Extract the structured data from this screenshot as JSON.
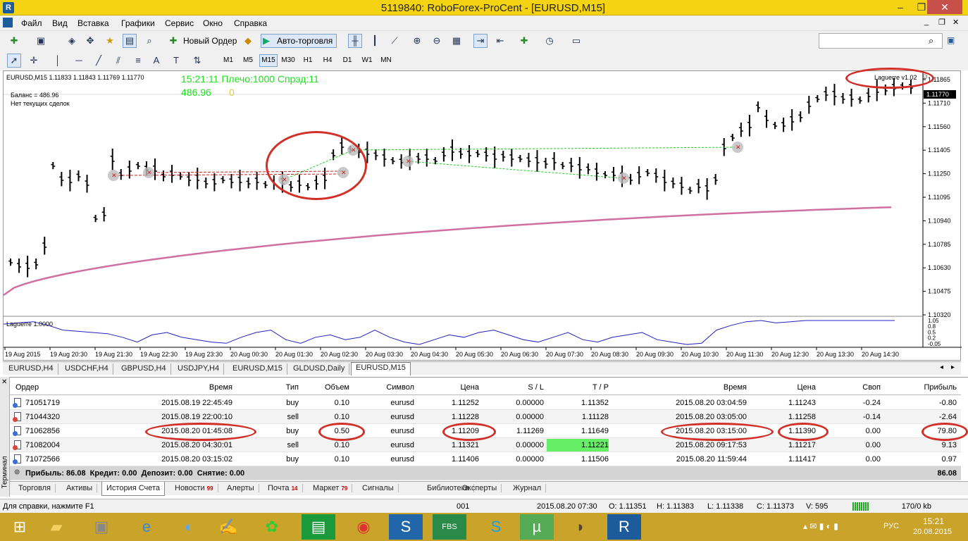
{
  "window": {
    "title": "5119840: RoboForex-ProCent - [EURUSD,M15]"
  },
  "menu": [
    "Файл",
    "Вид",
    "Вставка",
    "Графики",
    "Сервис",
    "Окно",
    "Справка"
  ],
  "toolbar": {
    "new_order": "Новый Ордер",
    "autotrading": "Авто-торговля"
  },
  "timeframes": [
    "M1",
    "M5",
    "M15",
    "M30",
    "H1",
    "H4",
    "D1",
    "W1",
    "MN"
  ],
  "timeframe_active": "M15",
  "chart": {
    "header": "EURUSD,M15  1.11833 1.11843 1.11769 1.11770",
    "info_time": "15:21:11 Плечо:1000 Спрэд:11",
    "info_balance": "486.96",
    "info_zero": "0",
    "balance_label": "Баланс = 486.96",
    "no_deals": "Нет текущих сделок",
    "indicator_badge": "Laguerre v1.02",
    "current_price": "1.11770",
    "price_ticks": [
      "1.11865",
      "1.11710",
      "1.11560",
      "1.11405",
      "1.11250",
      "1.11095",
      "1.10940",
      "1.10785",
      "1.10630",
      "1.10475",
      "1.10320"
    ],
    "sub_label": "Laguerre 1.0000",
    "sub_ticks": [
      "1.05",
      "0.8",
      "0.5",
      "0.2",
      "-0.05"
    ],
    "time_ticks": [
      "19 Aug 2015",
      "19 Aug 20:30",
      "19 Aug 21:30",
      "19 Aug 22:30",
      "19 Aug 23:30",
      "20 Aug 00:30",
      "20 Aug 01:30",
      "20 Aug 02:30",
      "20 Aug 03:30",
      "20 Aug 04:30",
      "20 Aug 05:30",
      "20 Aug 06:30",
      "20 Aug 07:30",
      "20 Aug 08:30",
      "20 Aug 09:30",
      "20 Aug 10:30",
      "20 Aug 11:30",
      "20 Aug 12:30",
      "20 Aug 13:30",
      "20 Aug 14:30"
    ],
    "colors": {
      "ma": "#d070a0",
      "laguerre": "#2020c0",
      "trade": "#22cc22",
      "trade_red": "#cc2222",
      "info": "#22dd22"
    }
  },
  "chart_tabs": [
    "EURUSD,H4",
    "USDCHF,H4",
    "GBPUSD,H4",
    "USDJPY,H4",
    "EURUSD,M15",
    "GLDUSD,Daily",
    "EURUSD,M15"
  ],
  "chart_tab_active": 6,
  "terminal": {
    "side_label": "Терминал",
    "headers": [
      "Ордер",
      "Время",
      "Тип",
      "Объем",
      "Символ",
      "Цена",
      "S / L",
      "T / P",
      "Время",
      "Цена",
      "Своп",
      "Прибыль"
    ],
    "rows": [
      {
        "order": "71051719",
        "open_time": "2015.08.19 22:45:49",
        "type": "buy",
        "volume": "0.10",
        "symbol": "eurusd",
        "price": "1.11252",
        "sl": "0.00000",
        "tp": "1.11352",
        "close_time": "2015.08.20 03:04:59",
        "close_price": "1.11243",
        "swap": "-0.24",
        "profit": "-0.80"
      },
      {
        "order": "71044320",
        "open_time": "2015.08.19 22:00:10",
        "type": "sell",
        "volume": "0.10",
        "symbol": "eurusd",
        "price": "1.11228",
        "sl": "0.00000",
        "tp": "1.11128",
        "close_time": "2015.08.20 03:05:00",
        "close_price": "1.11258",
        "swap": "-0.14",
        "profit": "-2.64"
      },
      {
        "order": "71062856",
        "open_time": "2015.08.20 01:45:08",
        "type": "buy",
        "volume": "0.50",
        "symbol": "eurusd",
        "price": "1.11209",
        "sl": "1.11269",
        "tp": "1.11649",
        "close_time": "2015.08.20 03:15:00",
        "close_price": "1.11390",
        "swap": "0.00",
        "profit": "79.80"
      },
      {
        "order": "71082004",
        "open_time": "2015.08.20 04:30:01",
        "type": "sell",
        "volume": "0.10",
        "symbol": "eurusd",
        "price": "1.11321",
        "sl": "0.00000",
        "tp": "1.11221",
        "close_time": "2015.08.20 09:17:53",
        "close_price": "1.11217",
        "swap": "0.00",
        "profit": "9.13"
      },
      {
        "order": "71072566",
        "open_time": "2015.08.20 03:15:02",
        "type": "buy",
        "volume": "0.10",
        "symbol": "eurusd",
        "price": "1.11406",
        "sl": "0.00000",
        "tp": "1.11506",
        "close_time": "2015.08.20 11:59:44",
        "close_price": "1.11417",
        "swap": "0.00",
        "profit": "0.97"
      }
    ],
    "summary": "Прибыль: 86.08  Кредит: 0.00  Депозит: 0.00  Снятие: 0.00",
    "summary_total": "86.08",
    "tabs": [
      "Торговля",
      "Активы",
      "История Счета",
      "Новости",
      "Алерты",
      "Почта",
      "Маркет",
      "Сигналы",
      "Библиотека",
      "Эксперты",
      "Журнал"
    ],
    "tab_badges": {
      "news": "99",
      "mail": "14",
      "market": "79"
    }
  },
  "status": {
    "help": "Для справки, нажмите F1",
    "profile": "001",
    "time": "2015.08.20 07:30",
    "open": "O: 1.11351",
    "high": "H: 1.11383",
    "low": "L: 1.11338",
    "close": "C: 1.11373",
    "volume": "V: 595",
    "traffic": "170/0 kb"
  },
  "taskbar": {
    "lang": "РУС",
    "clock_time": "15:21",
    "clock_date": "20.08.2015"
  }
}
